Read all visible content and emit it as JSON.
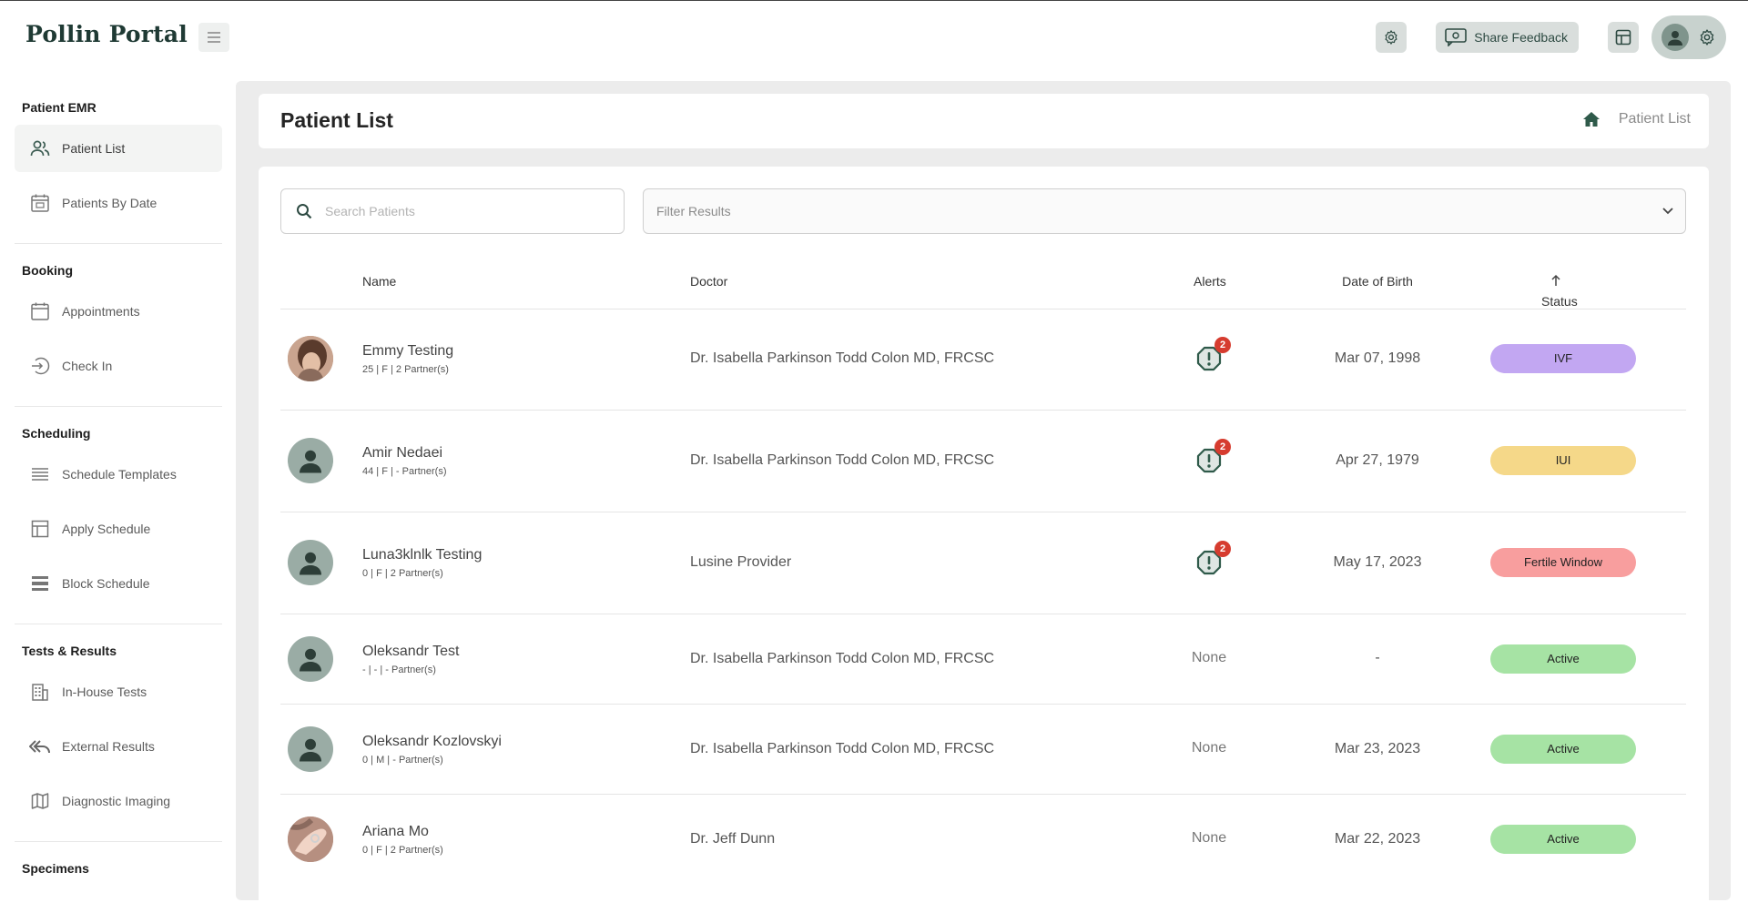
{
  "app": {
    "title": "Pollin Portal"
  },
  "header": {
    "feedback_label": "Share Feedback"
  },
  "sidebar": {
    "sections": [
      {
        "title": "Patient EMR",
        "items": [
          {
            "label": "Patient List",
            "icon": "users-icon"
          },
          {
            "label": "Patients By Date",
            "icon": "calendar-date-icon"
          }
        ]
      },
      {
        "title": "Booking",
        "items": [
          {
            "label": "Appointments",
            "icon": "calendar-icon"
          },
          {
            "label": "Check In",
            "icon": "sign-in-icon"
          }
        ]
      },
      {
        "title": "Scheduling",
        "items": [
          {
            "label": "Schedule Templates",
            "icon": "lines-icon"
          },
          {
            "label": "Apply Schedule",
            "icon": "layout-icon"
          },
          {
            "label": "Block Schedule",
            "icon": "block-icon"
          }
        ]
      },
      {
        "title": "Tests & Results",
        "items": [
          {
            "label": "In-House Tests",
            "icon": "building-icon"
          },
          {
            "label": "External Results",
            "icon": "reply-all-icon"
          },
          {
            "label": "Diagnostic Imaging",
            "icon": "map-icon"
          }
        ]
      },
      {
        "title": "Specimens",
        "items": []
      }
    ]
  },
  "page": {
    "title": "Patient List",
    "breadcrumb": "Patient List",
    "search_placeholder": "Search Patients",
    "filter_placeholder": "Filter Results"
  },
  "table": {
    "columns": {
      "name": "Name",
      "doctor": "Doctor",
      "alerts": "Alerts",
      "dob": "Date of Birth",
      "status": "Status"
    },
    "rows": [
      {
        "name": "Emmy Testing",
        "sub": "25 | F | 2 Partner(s)",
        "doctor": "Dr. Isabella Parkinson Todd Colon MD, FRCSC",
        "alerts": "2",
        "dob": "Mar 07, 1998",
        "status": "IVF",
        "status_color": "#c2a7f2",
        "avatar": "photo-1"
      },
      {
        "name": "Amir Nedaei",
        "sub": "44 | F | - Partner(s)",
        "doctor": "Dr. Isabella Parkinson Todd Colon MD, FRCSC",
        "alerts": "2",
        "dob": "Apr 27, 1979",
        "status": "IUI",
        "status_color": "#f5d889",
        "avatar": "default"
      },
      {
        "name": "Luna3klnlk Testing",
        "sub": "0 | F | 2 Partner(s)",
        "doctor": "Lusine Provider",
        "alerts": "2",
        "dob": "May 17, 2023",
        "status": "Fertile Window",
        "status_color": "#f89e9e",
        "avatar": "default"
      },
      {
        "name": "Oleksandr Test",
        "sub": "- | - | - Partner(s)",
        "doctor": "Dr. Isabella Parkinson Todd Colon MD, FRCSC",
        "alerts": "None",
        "dob": "-",
        "status": "Active",
        "status_color": "#a6e3a4",
        "avatar": "default"
      },
      {
        "name": "Oleksandr Kozlovskyi",
        "sub": "0 | M | - Partner(s)",
        "doctor": "Dr. Isabella Parkinson Todd Colon MD, FRCSC",
        "alerts": "None",
        "dob": "Mar 23, 2023",
        "status": "Active",
        "status_color": "#a6e3a4",
        "avatar": "default"
      },
      {
        "name": "Ariana Mo",
        "sub": "0 | F | 2 Partner(s)",
        "doctor": "Dr. Jeff Dunn",
        "alerts": "None",
        "dob": "Mar 22, 2023",
        "status": "Active",
        "status_color": "#a6e3a4",
        "avatar": "photo-2"
      }
    ]
  },
  "colors": {
    "brand": "#1f3a34",
    "alert_badge": "#d63c2f",
    "alert_icon": "#2f5a4a"
  }
}
